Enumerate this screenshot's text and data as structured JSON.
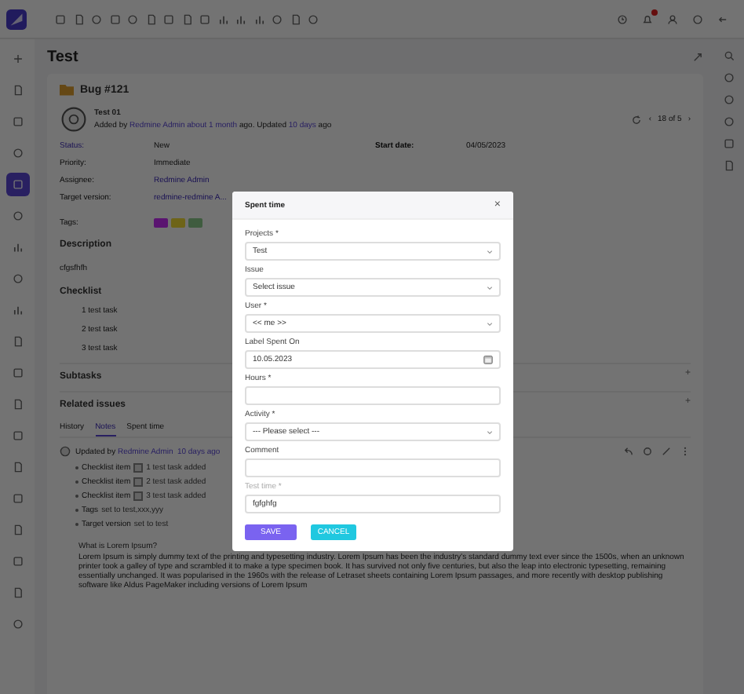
{
  "top_bar": {
    "notifications_unread": true
  },
  "sidebar": {
    "items": [
      {
        "selected": false
      },
      {
        "selected": false
      },
      {
        "selected": false
      },
      {
        "selected": false
      },
      {
        "selected": true
      },
      {
        "selected": false
      },
      {
        "selected": false
      },
      {
        "selected": false
      },
      {
        "selected": false
      },
      {
        "selected": false
      },
      {
        "selected": false
      },
      {
        "selected": false
      },
      {
        "selected": false
      },
      {
        "selected": false
      },
      {
        "selected": false
      },
      {
        "selected": false
      },
      {
        "selected": false
      },
      {
        "selected": false
      },
      {
        "selected": false
      }
    ]
  },
  "page": {
    "title": "Test"
  },
  "issue": {
    "tracker": "Bug #121",
    "subject": "Test 01",
    "pager": {
      "prev": "‹",
      "count": "18 of 5",
      "next": "›"
    },
    "byline": [
      {
        "text": "Added by ",
        "kind": "plain"
      },
      {
        "text": "Redmine Admin",
        "kind": "link"
      },
      {
        "text": "about 1 month",
        "kind": "link"
      },
      {
        "text": " ago. Updated ",
        "kind": "plain"
      },
      {
        "text": "10 days",
        "kind": "link"
      },
      {
        "text": " ago",
        "kind": "plain"
      }
    ],
    "attributes": [
      {
        "label": "Status:",
        "value": "New",
        "kind": "plain"
      },
      {
        "label": "Priority:",
        "value": "Immediate",
        "kind": "plain"
      },
      {
        "label": "Assignee:",
        "value": "Redmine Admin",
        "kind": "link"
      },
      {
        "label": "Target version:",
        "value": "redmine-redmine A...",
        "kind": "link"
      }
    ],
    "start": {
      "label": "Start date:",
      "value": "04/05/2023"
    },
    "tags": {
      "label": "Tags:",
      "items": [
        {
          "color": "#5a1470"
        },
        {
          "color": "#6e6418"
        },
        {
          "color": "#3f5c3f"
        }
      ]
    },
    "description": {
      "heading": "Description",
      "text": "cfgsfhfh"
    },
    "checklist": {
      "heading": "Checklist",
      "items": [
        "1 test task",
        "2 test task",
        "3 test task"
      ]
    },
    "sections": [
      {
        "title": "Subtasks",
        "action": "+"
      },
      {
        "title": "Related issues",
        "action": "+"
      }
    ],
    "tabs": [
      {
        "label": "History",
        "selected": false
      },
      {
        "label": "Notes",
        "selected": true
      },
      {
        "label": "Spent time",
        "selected": false
      }
    ],
    "journal": {
      "byline": [
        {
          "text": "Updated by ",
          "kind": "plain"
        },
        {
          "text": "Redmine Admin",
          "kind": "link"
        },
        {
          "text": " 10 days ago",
          "kind": "link"
        }
      ],
      "details": [
        {
          "label": "Checklist item",
          "box": true,
          "detail": "1 test task added"
        },
        {
          "label": "Checklist item",
          "box": true,
          "detail": "2 test task added"
        },
        {
          "label": "Checklist item",
          "box": true,
          "detail": "3 test task added"
        },
        {
          "label": "Tags",
          "box": false,
          "detail": "set to test,xxx,yyy"
        },
        {
          "label": "Target version",
          "box": false,
          "detail": "set to test"
        }
      ],
      "heading": "What is Lorem Ipsum?",
      "paragraph": "Lorem Ipsum is simply dummy text of the printing and typesetting industry. Lorem Ipsum has been the industry's standard dummy text ever since the 1500s, when an unknown printer took a galley of type and scrambled it to make a type specimen book. It has survived not only five centuries, but also the leap into electronic typesetting, remaining essentially unchanged. It was popularised in the 1960s with the release of Letraset sheets containing Lorem Ipsum passages, and more recently with desktop publishing software like Aldus PageMaker including versions of Lorem Ipsum"
    }
  },
  "modal": {
    "title": "Spent time",
    "close": "×",
    "fields": [
      {
        "label": "Projects *",
        "kind": "select",
        "value": "Test",
        "disabled": false
      },
      {
        "label": "Issue",
        "kind": "select",
        "value": "Select issue",
        "disabled": false
      },
      {
        "label": "User *",
        "kind": "select",
        "value": "<< me >>",
        "disabled": false
      },
      {
        "label": "Label Spent On",
        "kind": "date",
        "value": "10.05.2023",
        "disabled": false
      },
      {
        "label": "Hours *",
        "kind": "text",
        "disabled": false
      },
      {
        "label": "Activity *",
        "kind": "select",
        "value": "--- Please select ---",
        "disabled": false
      },
      {
        "label": "Comment",
        "kind": "text",
        "disabled": false
      },
      {
        "label": "Test time *",
        "kind": "text",
        "value": "fgfghfg",
        "disabled": true
      }
    ],
    "buttons": [
      {
        "label": "SAVE",
        "kind": "primary"
      },
      {
        "label": "CANCEL",
        "kind": "secondary"
      }
    ]
  }
}
